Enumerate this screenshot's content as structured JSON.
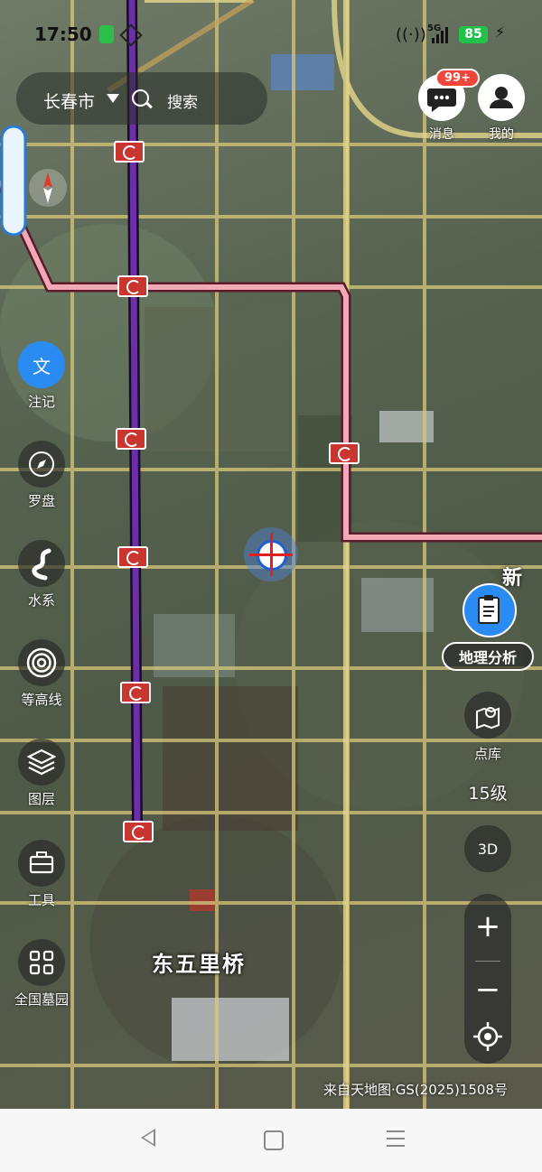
{
  "status": {
    "time": "17:50",
    "network": "5G",
    "battery": "85"
  },
  "search": {
    "city": "长春市",
    "label": "搜索"
  },
  "top_buttons": {
    "messages_label": "消息",
    "messages_badge": "99+",
    "me_label": "我的"
  },
  "left_tools": [
    {
      "label": "注记",
      "icon": "text-icon"
    },
    {
      "label": "罗盘",
      "icon": "compass-icon"
    },
    {
      "label": "水系",
      "icon": "river-icon"
    },
    {
      "label": "等高线",
      "icon": "contour-icon"
    },
    {
      "label": "图层",
      "icon": "layers-icon"
    },
    {
      "label": "工具",
      "icon": "toolbox-icon"
    },
    {
      "label": "全国墓园",
      "icon": "grid-icon"
    }
  ],
  "right_tools": {
    "geo_analysis_label": "地理分析",
    "points_label": "点库",
    "zoom_level": "15级",
    "mode_3d": "3D",
    "zoom_in": "+",
    "zoom_out": "−"
  },
  "map": {
    "place_name": "东五里桥",
    "partial_label": "新",
    "credit": "来自天地图·GS(2025)1508号"
  },
  "colors": {
    "accent": "#2a8bf2",
    "metro_purple": "#4b1a7a",
    "metro_pink": "#f1a9b6",
    "badge_red": "#f0453a"
  }
}
